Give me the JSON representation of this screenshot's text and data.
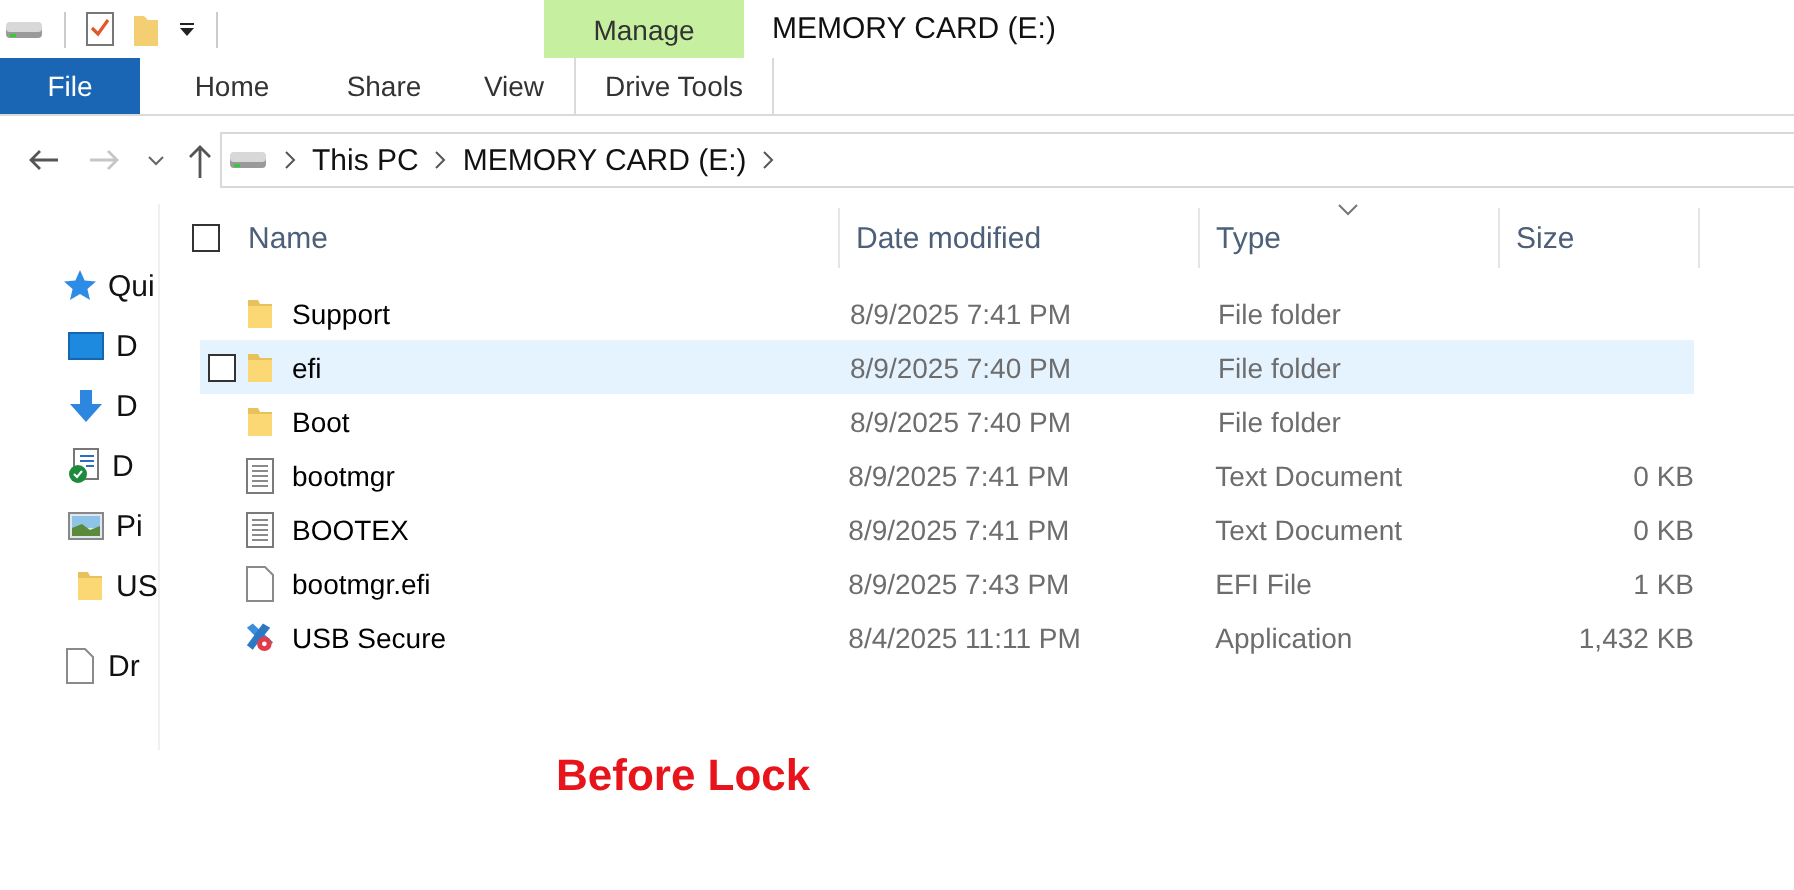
{
  "window": {
    "title": "MEMORY CARD (E:)"
  },
  "ribbon": {
    "contextual_header": "Manage",
    "tabs": [
      {
        "label": "File",
        "kind": "file"
      },
      {
        "label": "Home",
        "kind": "plain"
      },
      {
        "label": "Share",
        "kind": "plain"
      },
      {
        "label": "View",
        "kind": "plain"
      },
      {
        "label": "Drive Tools",
        "kind": "contextual"
      }
    ]
  },
  "address": {
    "path": [
      "This PC",
      "MEMORY CARD (E:)"
    ]
  },
  "navigation": [
    {
      "label": "Qui",
      "kind": "star"
    },
    {
      "label": "D",
      "kind": "desktop"
    },
    {
      "label": "D",
      "kind": "download"
    },
    {
      "label": "D",
      "kind": "document"
    },
    {
      "label": "Pi",
      "kind": "picture"
    },
    {
      "label": "US",
      "kind": "folder"
    },
    {
      "label": "Dr",
      "kind": "file",
      "separated": true
    }
  ],
  "file_list": {
    "columns": [
      "Name",
      "Date modified",
      "Type",
      "Size"
    ],
    "select_all_checked": false,
    "rows": [
      {
        "name": "Support",
        "date": "8/9/2025 7:41 PM",
        "type": "File folder",
        "kind": "folder",
        "selected": false
      },
      {
        "name": "efi",
        "date": "8/9/2025 7:40 PM",
        "type": "File folder",
        "kind": "folder",
        "selected": true
      },
      {
        "name": "Boot",
        "date": "8/9/2025 7:40 PM",
        "type": "File folder",
        "kind": "folder",
        "selected": false
      },
      {
        "name": "bootmgr",
        "date": "8/9/2025 7:41 PM",
        "type": "Text Document",
        "size": "0 KB",
        "kind": "text",
        "selected": false
      },
      {
        "name": "BOOTEX",
        "date": "8/9/2025 7:41 PM",
        "type": "Text Document",
        "size": "0 KB",
        "kind": "text",
        "selected": false
      },
      {
        "name": "bootmgr.efi",
        "date": "8/9/2025 7:43 PM",
        "type": "EFI File",
        "size": "1 KB",
        "kind": "file",
        "selected": false
      },
      {
        "name": "USB Secure",
        "date": "8/4/2025 11:11 PM",
        "type": "Application",
        "size": "1,432 KB",
        "kind": "app",
        "selected": false
      }
    ]
  },
  "caption": "Before Lock"
}
